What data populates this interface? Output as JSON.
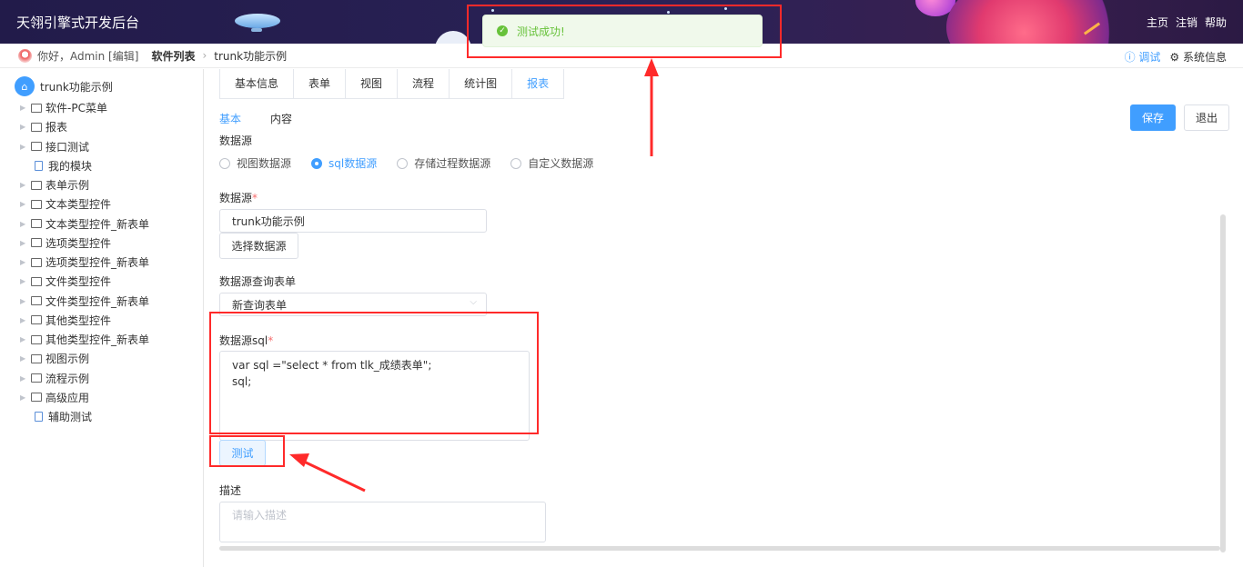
{
  "app": {
    "title": "天翎引擎式开发后台"
  },
  "top_nav": {
    "home": "主页",
    "logout": "注销",
    "help": "帮助"
  },
  "toast": {
    "message": "测试成功!"
  },
  "breadcrumb": {
    "greeting": "你好，Admin [编辑]",
    "software_list": "软件列表",
    "current": "trunk功能示例",
    "debug": "ⓘ 调试",
    "system_info": "⚙ 系统信息"
  },
  "sidebar": {
    "root": "trunk功能示例",
    "items": [
      {
        "label": "软件-PC菜单",
        "type": "folder"
      },
      {
        "label": "报表",
        "type": "folder"
      },
      {
        "label": "接口测试",
        "type": "folder"
      },
      {
        "label": "我的模块",
        "type": "file"
      },
      {
        "label": "表单示例",
        "type": "folder"
      },
      {
        "label": "文本类型控件",
        "type": "folder"
      },
      {
        "label": "文本类型控件_新表单",
        "type": "folder"
      },
      {
        "label": "选项类型控件",
        "type": "folder"
      },
      {
        "label": "选项类型控件_新表单",
        "type": "folder"
      },
      {
        "label": "文件类型控件",
        "type": "folder"
      },
      {
        "label": "文件类型控件_新表单",
        "type": "folder"
      },
      {
        "label": "其他类型控件",
        "type": "folder"
      },
      {
        "label": "其他类型控件_新表单",
        "type": "folder"
      },
      {
        "label": "视图示例",
        "type": "folder"
      },
      {
        "label": "流程示例",
        "type": "folder"
      },
      {
        "label": "高级应用",
        "type": "folder"
      },
      {
        "label": "辅助测试",
        "type": "file"
      }
    ]
  },
  "tabs": [
    "基本信息",
    "表单",
    "视图",
    "流程",
    "统计图",
    "报表"
  ],
  "subtabs": [
    "基本",
    "内容"
  ],
  "buttons": {
    "save": "保存",
    "exit": "退出"
  },
  "form": {
    "datasource_type_label": "数据源",
    "datasource_types": [
      "视图数据源",
      "sql数据源",
      "存储过程数据源",
      "自定义数据源"
    ],
    "datasource_label": "数据源",
    "datasource_value": "trunk功能示例",
    "select_datasource_button": "选择数据源",
    "query_form_label": "数据源查询表单",
    "query_form_value": "新查询表单",
    "sql_label": "数据源sql",
    "sql_value": "var sql =\"select * from tlk_成绩表单\";\nsql;",
    "test_button": "测试",
    "desc_label": "描述",
    "desc_placeholder": "请输入描述"
  },
  "colors": {
    "accent": "#409eff",
    "success": "#67c23a",
    "annotation": "#ff2a2a"
  }
}
